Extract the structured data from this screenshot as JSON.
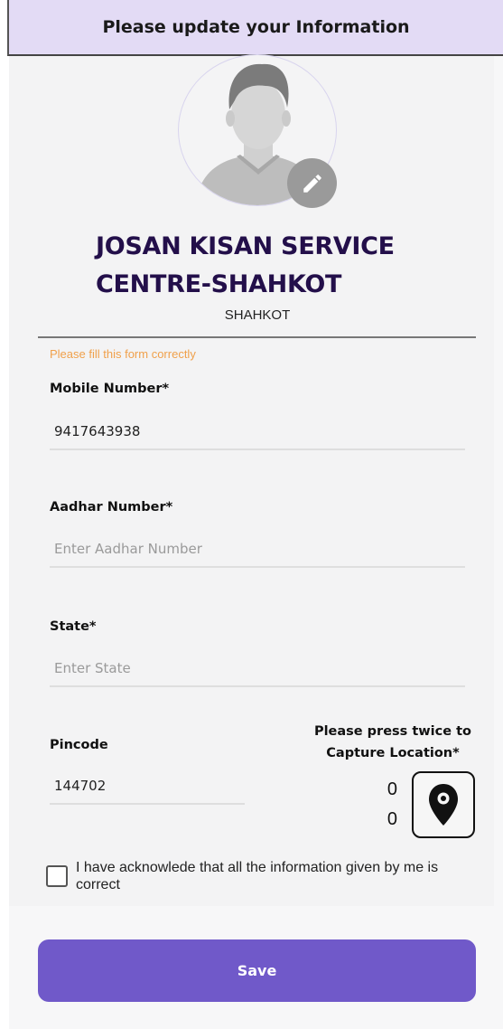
{
  "header": {
    "title": "Please update your Information"
  },
  "profile": {
    "avatar_icon": "user-silhouette-icon",
    "edit_icon": "pencil-icon",
    "centre_name": "JOSAN KISAN SERVICE CENTRE-SHAHKOT",
    "city": "SHAHKOT"
  },
  "form": {
    "hint": "Please fill this form correctly",
    "mobile": {
      "label": "Mobile Number*",
      "value": "9417643938",
      "placeholder": ""
    },
    "aadhar": {
      "label": "Aadhar Number*",
      "value": "",
      "placeholder": "Enter Aadhar Number"
    },
    "state": {
      "label": "State*",
      "value": "",
      "placeholder": "Enter State"
    },
    "pincode": {
      "label": "Pincode",
      "value": "144702",
      "placeholder": ""
    },
    "location": {
      "title": "Please press twice to Capture Location*",
      "latitude": "0",
      "longitude": "0",
      "icon": "map-pin-icon"
    },
    "acknowledge": {
      "checked": false,
      "text": "I have acknowlede that all the information given by me is correct"
    }
  },
  "save": {
    "label": "Save"
  },
  "colors": {
    "header_bg": "#e3dbf5",
    "title_text": "#230f4a",
    "hint_text": "#f0a04b",
    "save_button": "#7059c9"
  }
}
